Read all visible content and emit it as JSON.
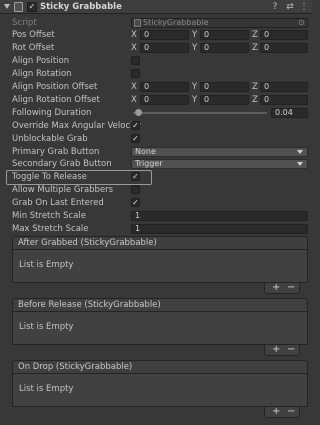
{
  "header": {
    "title": "Sticky Grabbable",
    "enabled": "✓",
    "help_icon": "?",
    "settings_icon": "⇄",
    "menu_icon": "⋮"
  },
  "script": {
    "label": "Script",
    "value": "StickyGrabbable",
    "target_icon": "⊙"
  },
  "axes": {
    "x": "X",
    "y": "Y",
    "z": "Z"
  },
  "pos_offset": {
    "label": "Pos Offset",
    "x": "0",
    "y": "0",
    "z": "0"
  },
  "rot_offset": {
    "label": "Rot Offset",
    "x": "0",
    "y": "0",
    "z": "0"
  },
  "align_position": {
    "label": "Align Position",
    "checked": ""
  },
  "align_rotation": {
    "label": "Align Rotation",
    "checked": ""
  },
  "align_position_offset": {
    "label": "Align Position Offset",
    "x": "0",
    "y": "0",
    "z": "0"
  },
  "align_rotation_offset": {
    "label": "Align Rotation Offset",
    "x": "0",
    "y": "0",
    "z": "0"
  },
  "following_duration": {
    "label": "Following Duration",
    "value": "0.04",
    "fraction": 0.04
  },
  "override_max_angular_velocity": {
    "label": "Override Max Angular Velocity",
    "checked": "✓"
  },
  "unblockable_grab": {
    "label": "Unblockable Grab",
    "checked": "✓"
  },
  "primary_grab_button": {
    "label": "Primary Grab Button",
    "value": "None"
  },
  "secondary_grab_button": {
    "label": "Secondary Grab Button",
    "value": "Trigger"
  },
  "toggle_to_release": {
    "label": "Toggle To Release",
    "checked": "✓"
  },
  "allow_multiple_grabbers": {
    "label": "Allow Multiple Grabbers",
    "checked": ""
  },
  "grab_on_last_entered": {
    "label": "Grab On Last Entered",
    "checked": "✓"
  },
  "min_stretch_scale": {
    "label": "Min Stretch Scale",
    "value": "1"
  },
  "max_stretch_scale": {
    "label": "Max Stretch Scale",
    "value": "1"
  },
  "events": [
    {
      "title": "After Grabbed (StickyGrabbable)",
      "empty": "List is Empty"
    },
    {
      "title": "Before Release (StickyGrabbable)",
      "empty": "List is Empty"
    },
    {
      "title": "On Drop (StickyGrabbable)",
      "empty": "List is Empty"
    }
  ],
  "list_controls": {
    "add": "+",
    "remove": "−"
  }
}
